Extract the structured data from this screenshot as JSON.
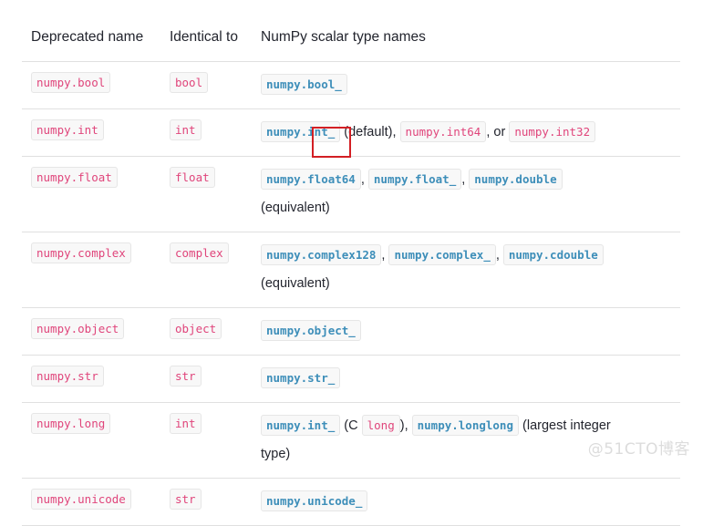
{
  "table": {
    "headers": [
      "Deprecated name",
      "Identical to",
      "NumPy scalar type names"
    ],
    "rows": [
      {
        "deprecated": "numpy.bool",
        "identical": "bool",
        "scalar_parts": [
          {
            "type": "code-teal",
            "text": "numpy.bool_"
          }
        ]
      },
      {
        "deprecated": "numpy.int",
        "identical": "int",
        "scalar_parts": [
          {
            "type": "code-teal",
            "text": "numpy.int_"
          },
          {
            "type": "text",
            "text": " (default), "
          },
          {
            "type": "code-pink",
            "text": "numpy.int64"
          },
          {
            "type": "text",
            "text": ", or "
          },
          {
            "type": "code-pink",
            "text": "numpy.int32"
          }
        ]
      },
      {
        "deprecated": "numpy.float",
        "identical": "float",
        "scalar_parts": [
          {
            "type": "code-teal",
            "text": "numpy.float64"
          },
          {
            "type": "text",
            "text": ", "
          },
          {
            "type": "code-teal",
            "text": "numpy.float_"
          },
          {
            "type": "text",
            "text": ", "
          },
          {
            "type": "code-teal",
            "text": "numpy.double"
          },
          {
            "type": "break",
            "text": ""
          },
          {
            "type": "text",
            "text": "(equivalent)"
          }
        ]
      },
      {
        "deprecated": "numpy.complex",
        "identical": "complex",
        "scalar_parts": [
          {
            "type": "code-teal",
            "text": "numpy.complex128"
          },
          {
            "type": "text",
            "text": ", "
          },
          {
            "type": "code-teal",
            "text": "numpy.complex_"
          },
          {
            "type": "text",
            "text": ", "
          },
          {
            "type": "code-teal",
            "text": "numpy.cdouble"
          },
          {
            "type": "break",
            "text": ""
          },
          {
            "type": "text",
            "text": "(equivalent)"
          }
        ]
      },
      {
        "deprecated": "numpy.object",
        "identical": "object",
        "scalar_parts": [
          {
            "type": "code-teal",
            "text": "numpy.object_"
          }
        ]
      },
      {
        "deprecated": "numpy.str",
        "identical": "str",
        "scalar_parts": [
          {
            "type": "code-teal",
            "text": "numpy.str_"
          }
        ]
      },
      {
        "deprecated": "numpy.long",
        "identical": "int",
        "scalar_parts": [
          {
            "type": "code-teal",
            "text": "numpy.int_"
          },
          {
            "type": "text",
            "text": " (C "
          },
          {
            "type": "code-pink",
            "text": "long"
          },
          {
            "type": "text",
            "text": "), "
          },
          {
            "type": "code-teal",
            "text": "numpy.longlong"
          },
          {
            "type": "text",
            "text": " (largest integer "
          },
          {
            "type": "break",
            "text": ""
          },
          {
            "type": "text",
            "text": "type)"
          }
        ]
      },
      {
        "deprecated": "numpy.unicode",
        "identical": "str",
        "scalar_parts": [
          {
            "type": "code-teal",
            "text": "numpy.unicode_"
          }
        ]
      }
    ]
  },
  "annotation": {
    "label": "red-highlight-rectangle",
    "color": "#d31f24",
    "target_text": "int_"
  },
  "watermark": {
    "text": "@51CTO博客"
  },
  "colors": {
    "deprecated_code": "#e0457b",
    "scalar_code": "#3d8eb9",
    "chip_background": "#f8f8f8",
    "chip_border": "#e6e6e6",
    "row_separator": "#e0e0e0",
    "header_text": "#23252e",
    "annotation": "#d31f24",
    "watermark": "#dcdcdc"
  }
}
